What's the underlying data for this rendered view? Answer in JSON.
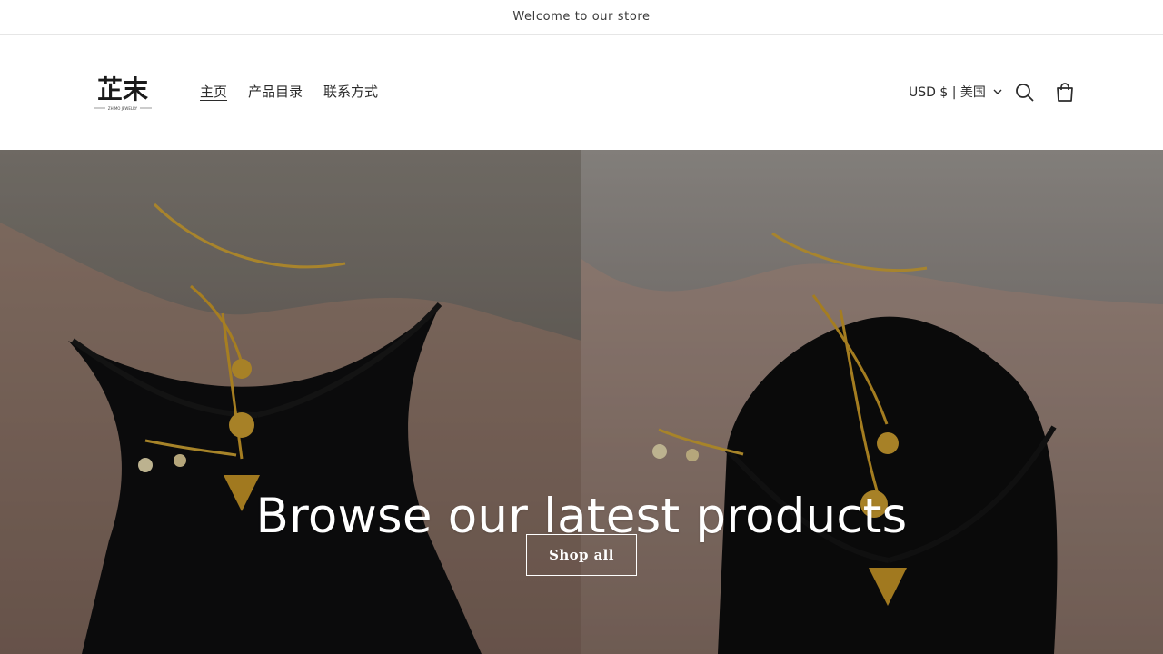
{
  "announcement": {
    "text": "Welcome to our store"
  },
  "header": {
    "logo": {
      "chinese": "芷末",
      "caption": "ZHIMO JEWELRY"
    },
    "nav": [
      {
        "label": "主页",
        "active": true
      },
      {
        "label": "产品目录",
        "active": false
      },
      {
        "label": "联系方式",
        "active": false
      }
    ],
    "country_selector": "USD $ | 美国",
    "icons": {
      "search": "search-icon",
      "cart": "cart-icon",
      "chevron": "chevron-down-icon"
    }
  },
  "hero": {
    "heading": "Browse our latest products",
    "button_label": "Shop all"
  }
}
